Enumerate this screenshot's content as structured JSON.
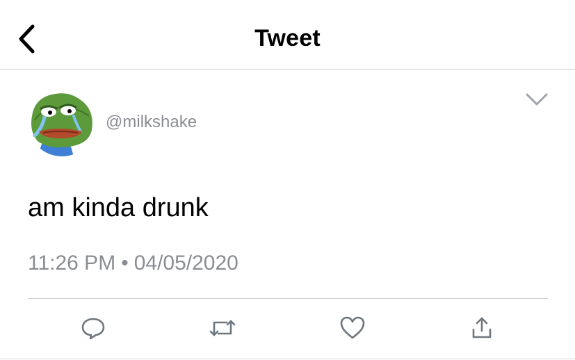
{
  "header": {
    "title": "Tweet",
    "back_icon": "chevron-left-icon"
  },
  "tweet": {
    "handle": "@milkshake",
    "text": "am kinda drunk",
    "time": "11:26 PM",
    "separator": "•",
    "date": "04/05/2020",
    "menu_icon": "chevron-down-icon"
  },
  "actions": [
    {
      "icon": "reply-icon"
    },
    {
      "icon": "retweet-icon"
    },
    {
      "icon": "like-icon"
    },
    {
      "icon": "share-icon"
    }
  ],
  "colors": {
    "text_primary": "#000000",
    "text_secondary": "#8a8d91",
    "icon_gray": "#6e767d",
    "divider": "#d0d0d0"
  }
}
